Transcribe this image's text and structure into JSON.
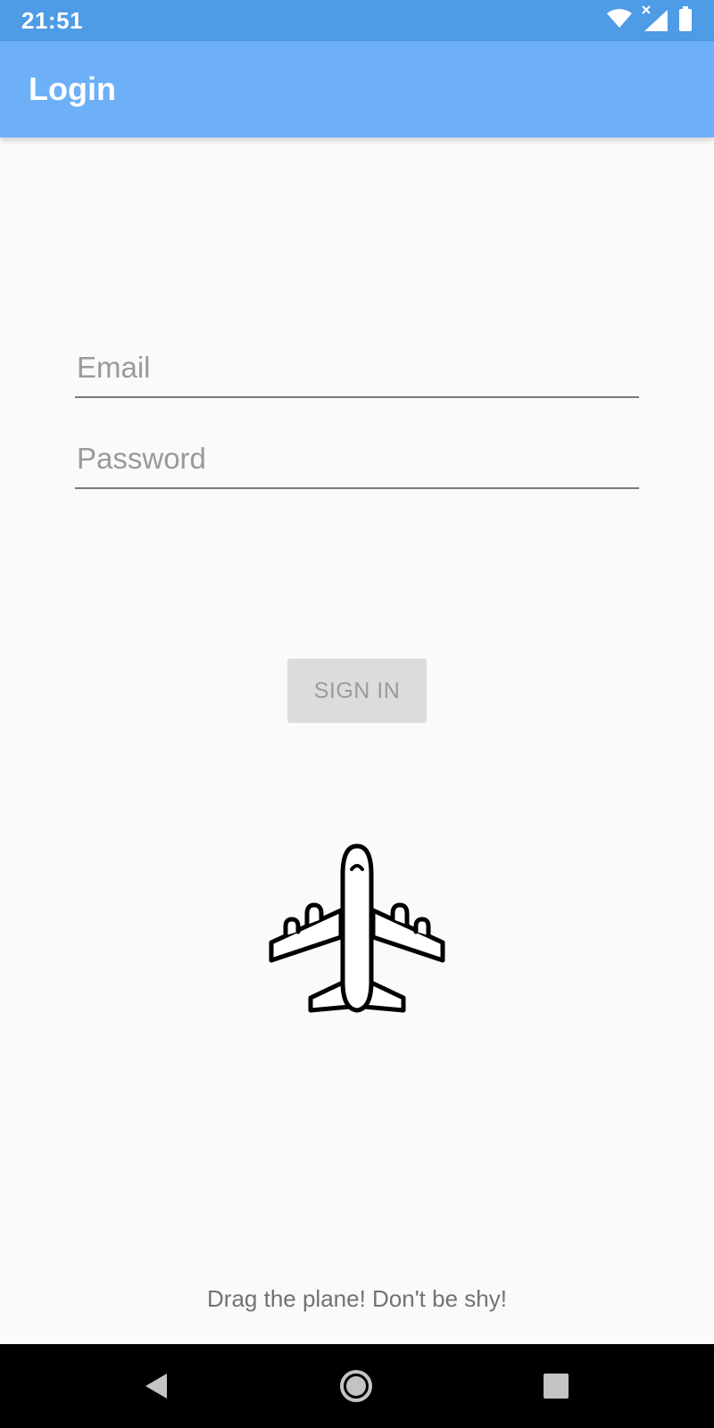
{
  "status_bar": {
    "time": "21:51",
    "icons": [
      "wifi-icon",
      "signal-icon",
      "battery-icon"
    ]
  },
  "app_bar": {
    "title": "Login"
  },
  "form": {
    "email_placeholder": "Email",
    "email_value": "",
    "password_placeholder": "Password",
    "password_value": "",
    "sign_in_label": "SIGN IN"
  },
  "plane": {
    "icon": "airplane-icon"
  },
  "hint": {
    "text": "Drag the plane! Don't be shy!"
  },
  "nav_bar": {
    "icons": [
      "back-icon",
      "home-icon",
      "recent-apps-icon"
    ]
  },
  "colors": {
    "status_bar": "#4e9be6",
    "app_bar": "#6db0f8",
    "background": "#fafafa",
    "button_disabled": "#dcdcdc"
  }
}
